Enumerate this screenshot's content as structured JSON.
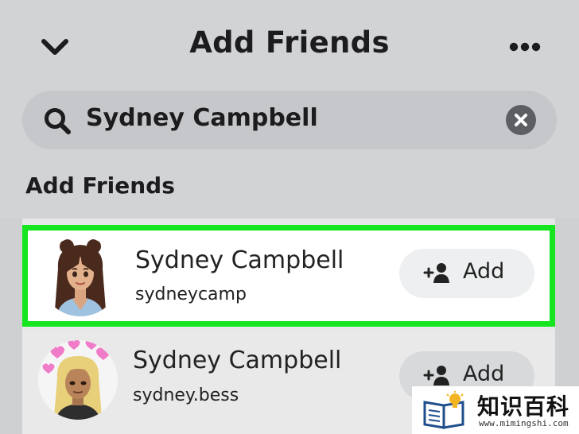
{
  "header": {
    "title": "Add Friends",
    "back_icon": "chevron-down-icon",
    "more_icon": "more-horizontal-icon"
  },
  "search": {
    "value": "Sydney Campbell",
    "icon": "search-icon",
    "clear_icon": "clear-icon"
  },
  "section": {
    "label": "Add Friends"
  },
  "results": [
    {
      "name": "Sydney Campbell",
      "username": "sydneycamp",
      "button_label": "Add",
      "highlighted": true
    },
    {
      "name": "Sydney Campbell",
      "username": "sydney.bess",
      "button_label": "Add",
      "highlighted": false
    }
  ],
  "watermark": {
    "title": "知识百科",
    "url": "www.mimingshi.com"
  },
  "colors": {
    "highlight": "#15e620",
    "background": "#d2d3d5",
    "search_bg": "#c6c7ca"
  }
}
